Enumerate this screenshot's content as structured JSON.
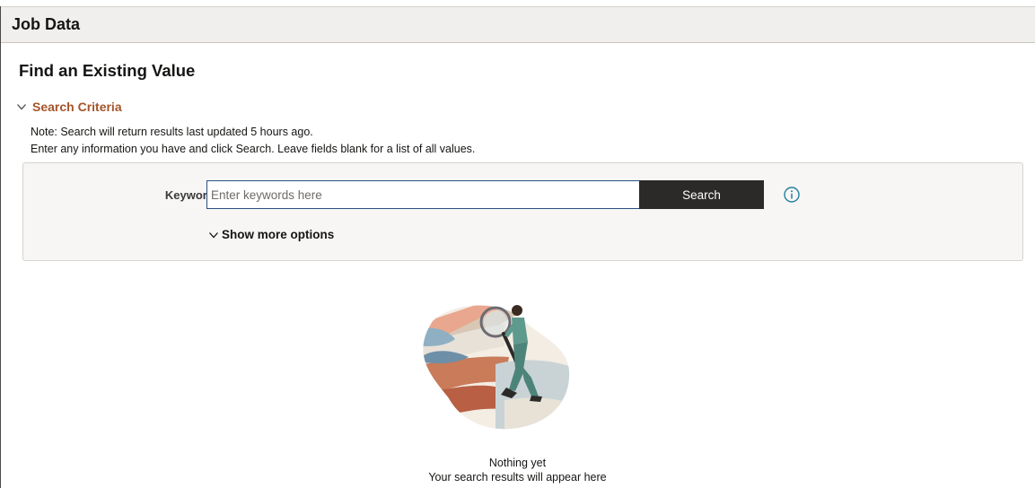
{
  "window": {
    "title": "Job Data"
  },
  "page": {
    "heading": "Find an Existing Value"
  },
  "search_criteria": {
    "toggle_label": "Search Criteria",
    "note_line1": "Note: Search will return results last updated 5 hours ago.",
    "note_line2": "Enter any information you have and click Search. Leave fields blank for a list of all values."
  },
  "search_panel": {
    "keywords_label": "Keywords",
    "keywords_placeholder": "Enter keywords here",
    "keywords_value": "",
    "search_button": "Search",
    "show_more_label": "Show more options"
  },
  "empty_state": {
    "title": "Nothing yet",
    "subtitle": "Your search results will appear here"
  },
  "icons": {
    "criteria_chevron": "chevron-down-icon",
    "info": "info-circle-icon",
    "more_chevron": "chevron-down-icon"
  },
  "colors": {
    "accent": "#a4552a",
    "button_bg": "#2b2a28",
    "input_border": "#2a4f80",
    "info_icon": "#227e9e",
    "header_bg": "#f1efed"
  }
}
